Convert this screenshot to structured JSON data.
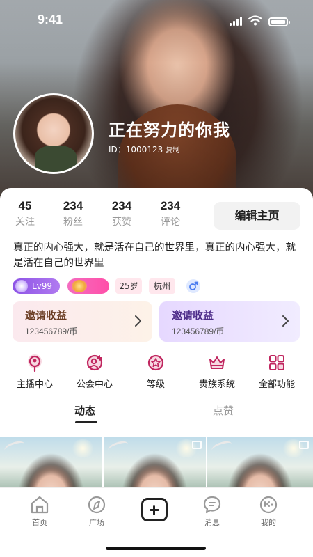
{
  "status_bar": {
    "time": "9:41"
  },
  "profile": {
    "name": "正在努力的你我",
    "id_text": "ID：1000123",
    "copy_label": "复制"
  },
  "stats": [
    {
      "value": "45",
      "label": "关注"
    },
    {
      "value": "234",
      "label": "粉丝"
    },
    {
      "value": "234",
      "label": "获赞"
    },
    {
      "value": "234",
      "label": "评论"
    }
  ],
  "edit_button": "编辑主页",
  "bio": "真正的内心强大，就是活在自己的世界里，真正的内心强大，就是活在自己的世界里",
  "tags": {
    "level": "Lv99",
    "age": "25岁",
    "city": "杭州",
    "gender": "male"
  },
  "invite_cards": [
    {
      "title": "邀请收益",
      "value": "123456789/币"
    },
    {
      "title": "邀请收益",
      "value": "123456789/币"
    }
  ],
  "functions": [
    {
      "label": "主播中心",
      "icon": "anchor-center-icon"
    },
    {
      "label": "公会中心",
      "icon": "guild-center-icon"
    },
    {
      "label": "等级",
      "icon": "level-star-icon"
    },
    {
      "label": "贵族系统",
      "icon": "crown-icon"
    },
    {
      "label": "全部功能",
      "icon": "grid-icon"
    }
  ],
  "content_tabs": {
    "active": "动态",
    "inactive": "点赞"
  },
  "tab_bar": {
    "home": "首页",
    "square": "广场",
    "message": "消息",
    "mine": "我的"
  },
  "colors": {
    "accent": "#c0265f",
    "level_tag": "#8d53e6",
    "rank_tag": "#f46cc0",
    "invite_left_bg": "#fbe9ee",
    "invite_right_bg": "#e6d8ff"
  }
}
